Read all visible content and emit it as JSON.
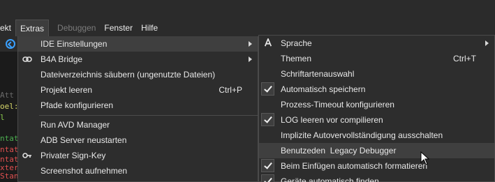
{
  "menubar": {
    "items": [
      {
        "label": "ekt",
        "state": "normal"
      },
      {
        "label": "Extras",
        "state": "active"
      },
      {
        "label": "Debuggen",
        "state": "disabled"
      },
      {
        "label": "Fenster",
        "state": "normal"
      },
      {
        "label": "Hilfe",
        "state": "normal"
      }
    ]
  },
  "editor": {
    "lines": [
      {
        "text": "Att",
        "color": "#6a6a6a"
      },
      {
        "text": "oel:",
        "color": "#d6d66a"
      },
      {
        "text": "l",
        "color": "#8fd14f"
      },
      {
        "text": "",
        "color": "#ffffff"
      },
      {
        "text": "ntat",
        "color": "#4caf50"
      },
      {
        "text": "ntat",
        "color": "#e05050"
      },
      {
        "text": "ntat",
        "color": "#e05050"
      },
      {
        "text": "xter",
        "color": "#e05050"
      },
      {
        "text": "Stan",
        "color": "#e05050"
      }
    ]
  },
  "extras_menu": {
    "items": [
      {
        "label": "IDE Einstellungen",
        "icon": "none",
        "submenu": true,
        "highlighted": true
      },
      {
        "label": "B4A Bridge",
        "icon": "link-icon",
        "submenu": true
      },
      {
        "label": "Dateiverzeichnis säubern (ungenutzte Dateien)"
      },
      {
        "label": "Projekt leeren",
        "shortcut": "Ctrl+P"
      },
      {
        "label": "Pfade konfigurieren"
      },
      {
        "separator": true
      },
      {
        "label": "Run AVD Manager"
      },
      {
        "label": "ADB Server neustarten"
      },
      {
        "label": "Privater Sign-Key",
        "icon": "key-icon"
      },
      {
        "label": "Screenshot aufnehmen"
      }
    ]
  },
  "ide_settings_submenu": {
    "items": [
      {
        "label": "Sprache",
        "icon": "font-icon",
        "submenu": true
      },
      {
        "label": "Themen",
        "shortcut": "Ctrl+T"
      },
      {
        "label": "Schriftartenauswahl"
      },
      {
        "label": "Automatisch speichern",
        "checked": true
      },
      {
        "label": "Prozess-Timeout konfigurieren"
      },
      {
        "label": "LOG leeren vor compilieren",
        "checked": true
      },
      {
        "label": "Implizite Autovervollständigung ausschalten"
      },
      {
        "label": "Benutzeden  Legacy Debugger",
        "highlighted": true
      },
      {
        "label": "Beim Einfügen automatisch formatieren",
        "checked": true
      },
      {
        "label": "Geräte automatisch finden",
        "checked": true
      }
    ]
  },
  "colors": {
    "background": "#1e1e1e",
    "menu_bg": "#2d2d2d",
    "highlight": "#3f3f3f",
    "accent_blue": "#3aa0ff"
  }
}
